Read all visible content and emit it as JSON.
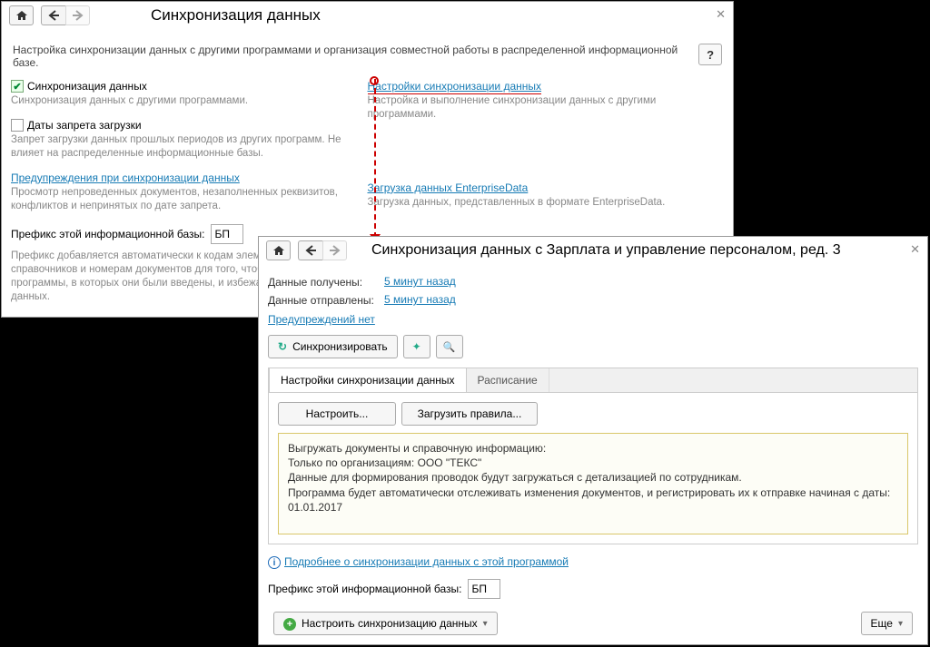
{
  "back": {
    "title": "Синхронизация данных",
    "desc": "Настройка синхронизации данных с другими программами и организация совместной работы в распределенной информационной базе.",
    "left": {
      "sync_chk_label": "Синхронизация данных",
      "sync_chk_checked": true,
      "sync_hint": "Синхронизация данных с другими программами.",
      "dates_chk_label": "Даты запрета загрузки",
      "dates_hint": "Запрет загрузки данных прошлых периодов из других программ. Не влияет на распределенные информационные базы.",
      "warn_link": "Предупреждения при синхронизации данных",
      "warn_hint": "Просмотр непроведенных документов, незаполненных реквизитов, конфликтов и непринятых по дате запрета.",
      "prefix_label": "Префикс этой информационной базы:",
      "prefix_value": "БП",
      "prefix_hint": "Префикс добавляется автоматически к кодам элементов справочников и номерам документов для того, чтобы различать программы, в которых они были введены, и избежать дублирования данных."
    },
    "right": {
      "settings_link": "Настройки синхронизации данных",
      "settings_hint": "Настройка и выполнение синхронизации данных с другими программами.",
      "load_link": "Загрузка данных EnterpriseData",
      "load_hint": "Загрузка данных, представленных в формате EnterpriseData."
    }
  },
  "front": {
    "title": "Синхронизация данных с Зарплата и управление персоналом, ред. 3",
    "recv_label": "Данные получены:",
    "sent_label": "Данные отправлены:",
    "time_ago": "5 минут назад",
    "warn_none": "Предупреждений нет",
    "sync_btn": "Синхронизировать",
    "tabs": {
      "settings": "Настройки синхронизации данных",
      "schedule": "Расписание"
    },
    "configure_btn": "Настроить...",
    "load_rules_btn": "Загрузить правила...",
    "infobox": {
      "l1": "Выгружать документы и справочную информацию:",
      "l2": "Только по организациям: ООО \"ТЕКС\"",
      "l3": "Данные для формирования проводок будут загружаться с детализацией по сотрудникам.",
      "l4": "Программа будет автоматически отслеживать изменения документов, и регистрировать их к отправке начиная с даты: 01.01.2017"
    },
    "more_link": "Подробнее о синхронизации данных с этой программой",
    "prefix_label": "Префикс этой информационной базы:",
    "prefix_value": "БП",
    "setup_sync_btn": "Настроить синхронизацию данных",
    "more_btn": "Еще"
  }
}
